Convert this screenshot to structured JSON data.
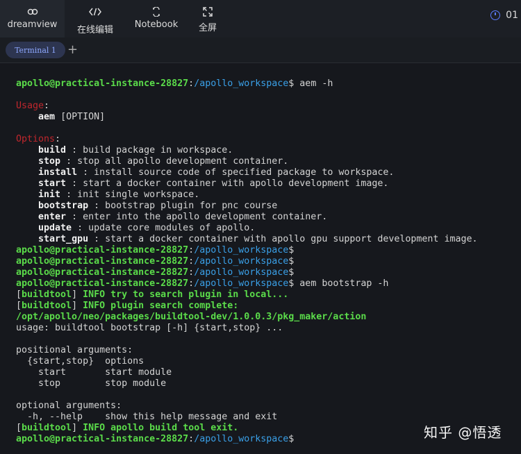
{
  "nav": [
    {
      "label": "dreamview",
      "icon": "link-icon"
    },
    {
      "label": "在线编辑",
      "icon": "code-icon"
    },
    {
      "label": "Notebook",
      "icon": "notebook-icon"
    },
    {
      "label": "全屏",
      "icon": "fullscreen-icon"
    }
  ],
  "timer": {
    "value": "01"
  },
  "tabs": [
    {
      "label": "Terminal 1"
    }
  ],
  "add_tab_label": "+",
  "terminal": {
    "prompt_user": "apollo@practical-instance-28827",
    "prompt_sep": ":",
    "prompt_path": "/apollo_workspace",
    "prompt_end": "$",
    "lines": [
      {
        "cmd": " aem -h"
      },
      {
        "blank": true
      },
      {
        "label": "Usage",
        "colon": ":"
      },
      {
        "indent": "    ",
        "name": "aem",
        "text": " [OPTION]"
      },
      {
        "blank": true
      },
      {
        "label": "Options",
        "colon": ":"
      },
      {
        "indent": "    ",
        "name": "build",
        "text": " : build package in workspace."
      },
      {
        "indent": "    ",
        "name": "stop",
        "text": " : stop all apollo development container."
      },
      {
        "indent": "    ",
        "name": "install",
        "text": " : install source code of specified package to workspace."
      },
      {
        "indent": "    ",
        "name": "start",
        "text": " : start a docker container with apollo development image."
      },
      {
        "indent": "    ",
        "name": "init",
        "text": " : init single workspace."
      },
      {
        "indent": "    ",
        "name": "bootstrap",
        "text": " : bootstrap plugin for pnc course"
      },
      {
        "indent": "    ",
        "name": "enter",
        "text": " : enter into the apollo development container."
      },
      {
        "indent": "    ",
        "name": "update",
        "text": " : update core modules of apollo."
      },
      {
        "indent": "    ",
        "name": "start_gpu",
        "text": " : start a docker container with apollo gpu support development image."
      },
      {
        "cmd": ""
      },
      {
        "cmd": ""
      },
      {
        "cmd": ""
      },
      {
        "cmd": " aem bootstrap -h"
      },
      {
        "bracket_open": "[",
        "tag": "buildtool",
        "bracket_close": "]",
        "info": " INFO try to search plugin in local..."
      },
      {
        "bracket_open": "[",
        "tag": "buildtool",
        "bracket_close": "]",
        "info": " INFO plugin search complete:"
      },
      {
        "path": "/opt/apollo/neo/packages/buildtool-dev/1.0.0.3/pkg_maker/action"
      },
      {
        "plain": "usage: buildtool bootstrap [-h] {start,stop} ..."
      },
      {
        "blank": true
      },
      {
        "plain": "positional arguments:"
      },
      {
        "plain": "  {start,stop}  options"
      },
      {
        "plain": "    start       start module"
      },
      {
        "plain": "    stop        stop module"
      },
      {
        "blank": true
      },
      {
        "plain": "optional arguments:"
      },
      {
        "plain": "  -h, --help    show this help message and exit"
      },
      {
        "bracket_open": "[",
        "tag": "buildtool",
        "bracket_close": "]",
        "info": " INFO apollo build tool exit."
      },
      {
        "cmd": ""
      }
    ]
  },
  "watermark": "知乎 @悟透"
}
